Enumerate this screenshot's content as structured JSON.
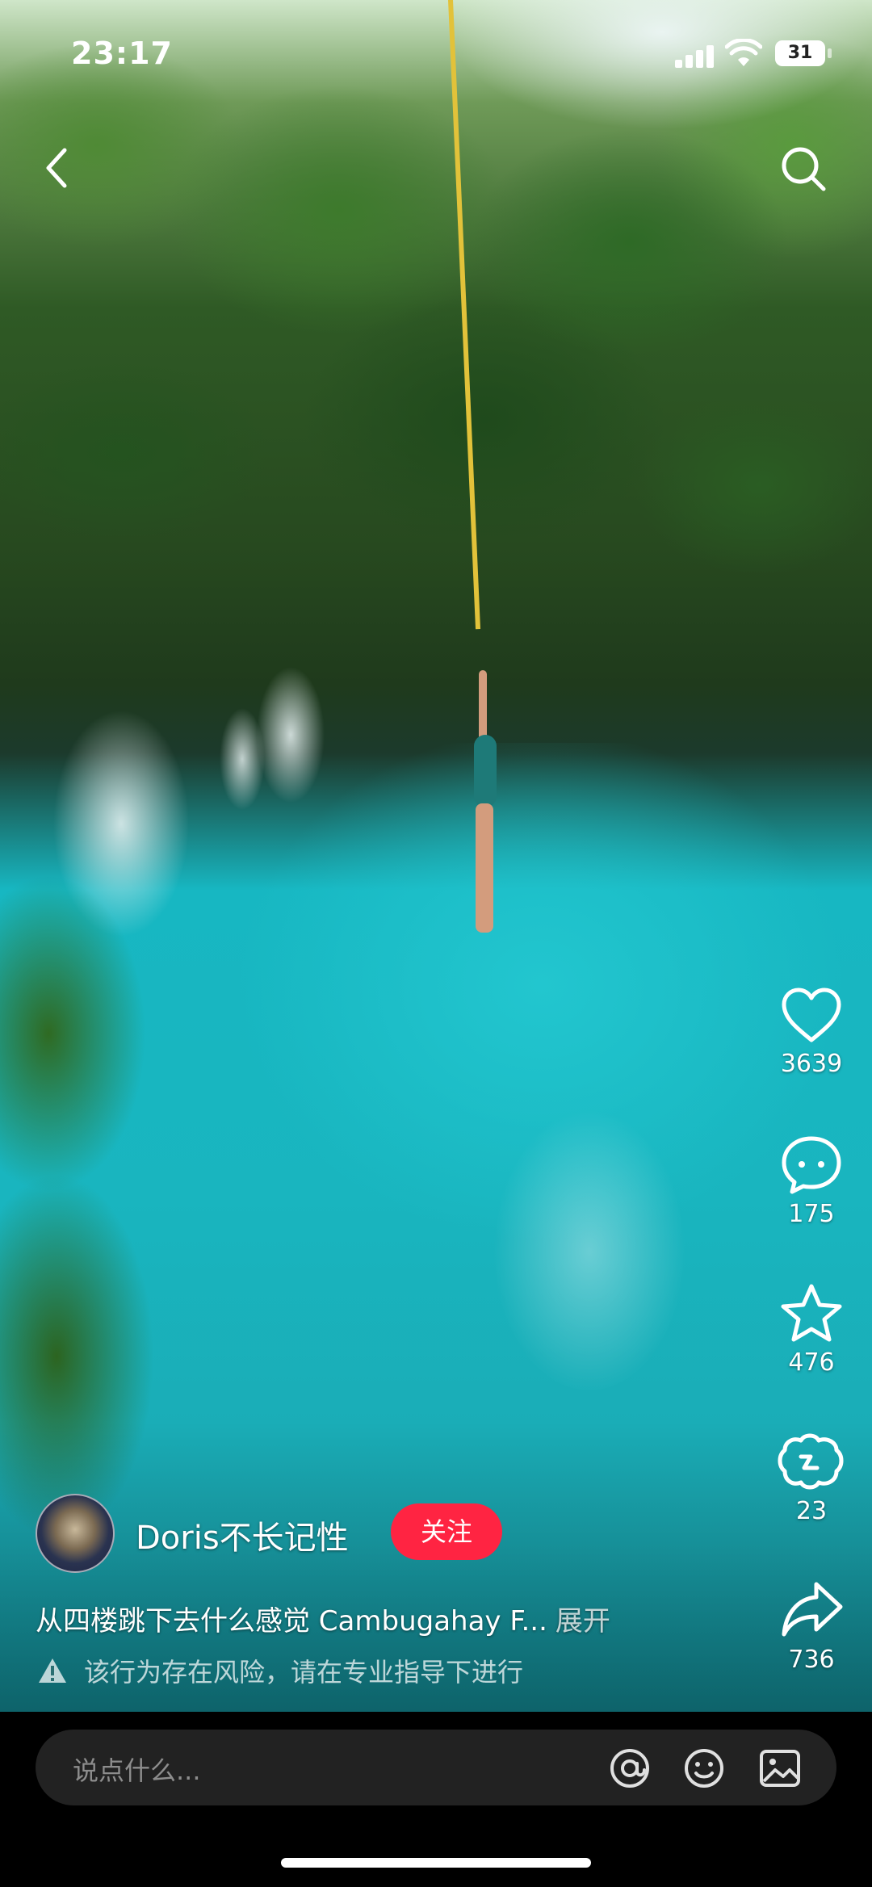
{
  "status": {
    "time": "23:17",
    "battery": "31"
  },
  "author": {
    "name": "Doris不长记性",
    "follow_label": "关注"
  },
  "post": {
    "caption": "从四楼跳下去什么感觉 Cambugahay F...",
    "expand_label": "展开",
    "warning": "该行为存在风险，请在专业指导下进行"
  },
  "actions": {
    "likes": "3639",
    "comments": "175",
    "favorites": "476",
    "shares_special": "23",
    "shares": "736"
  },
  "comment_bar": {
    "placeholder": "说点什么..."
  },
  "colors": {
    "follow_button": "#ff2442",
    "comment_bar_bg": "#222222",
    "water": "#19b5bf"
  },
  "icons": [
    "back-icon",
    "search-icon",
    "heart-icon",
    "comment-icon",
    "star-icon",
    "special-share-icon",
    "share-icon",
    "warning-icon",
    "at-icon",
    "emoji-icon",
    "image-icon"
  ]
}
